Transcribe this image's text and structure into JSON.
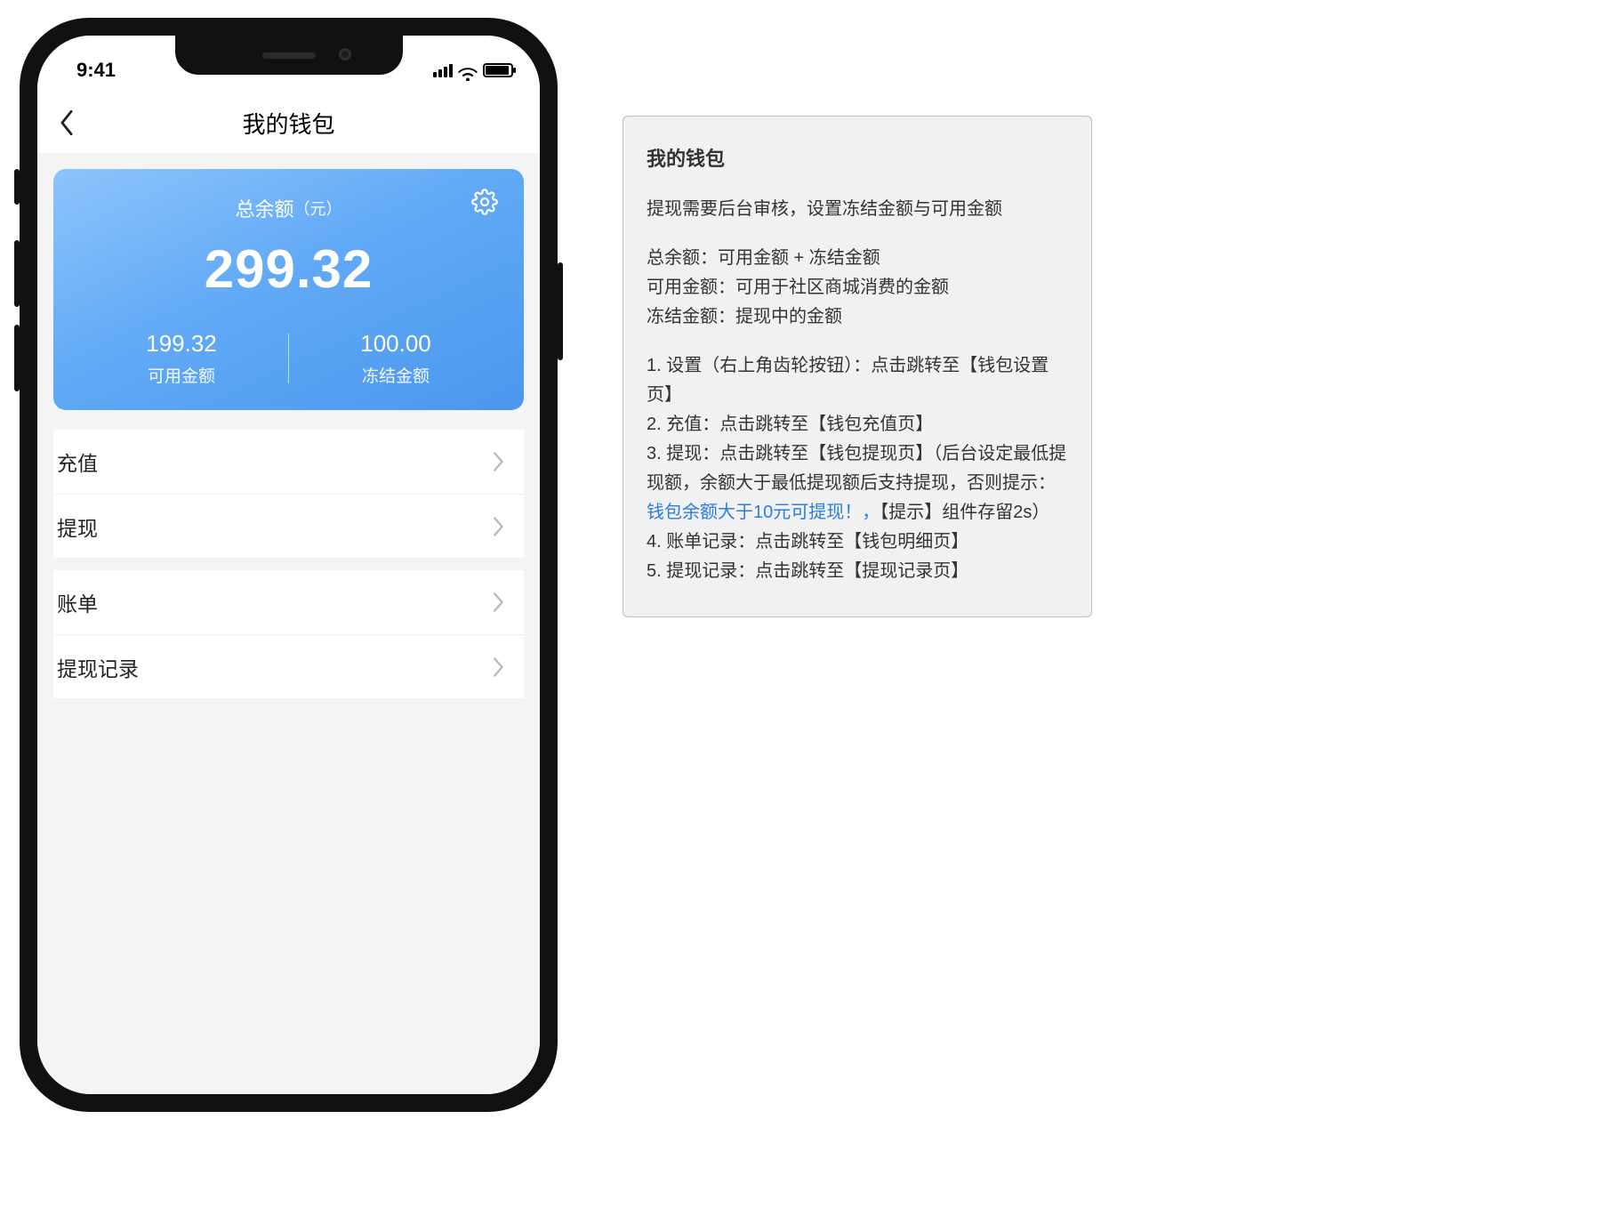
{
  "status": {
    "time": "9:41"
  },
  "nav": {
    "title": "我的钱包"
  },
  "balance": {
    "title": "总余额",
    "unit": "（元）",
    "total": "299.32",
    "available_value": "199.32",
    "available_label": "可用金额",
    "frozen_value": "100.00",
    "frozen_label": "冻结金额"
  },
  "actions": {
    "recharge": "充值",
    "withdraw": "提现",
    "bill": "账单",
    "withdraw_log": "提现记录"
  },
  "annotation": {
    "title": "我的钱包",
    "intro": "提现需要后台审核，设置冻结金额与可用金额",
    "def1": "总余额：可用金额 + 冻结金额",
    "def2": "可用金额：可用于社区商城消费的金额",
    "def3": "冻结金额：提现中的金额",
    "li1": "1. 设置（右上角齿轮按钮）：点击跳转至【钱包设置页】",
    "li2": "2. 充值：点击跳转至【钱包充值页】",
    "li3a": "3. 提现：点击跳转至【钱包提现页】（后台设定最低提现额，余额大于最低提现额后支持提现，否则提示：",
    "li3_link": "钱包余额大于10元可提现！，",
    "li3b": "【提示】组件存留2s）",
    "li4": "4. 账单记录：点击跳转至【钱包明细页】",
    "li5": "5. 提现记录：点击跳转至【提现记录页】"
  }
}
